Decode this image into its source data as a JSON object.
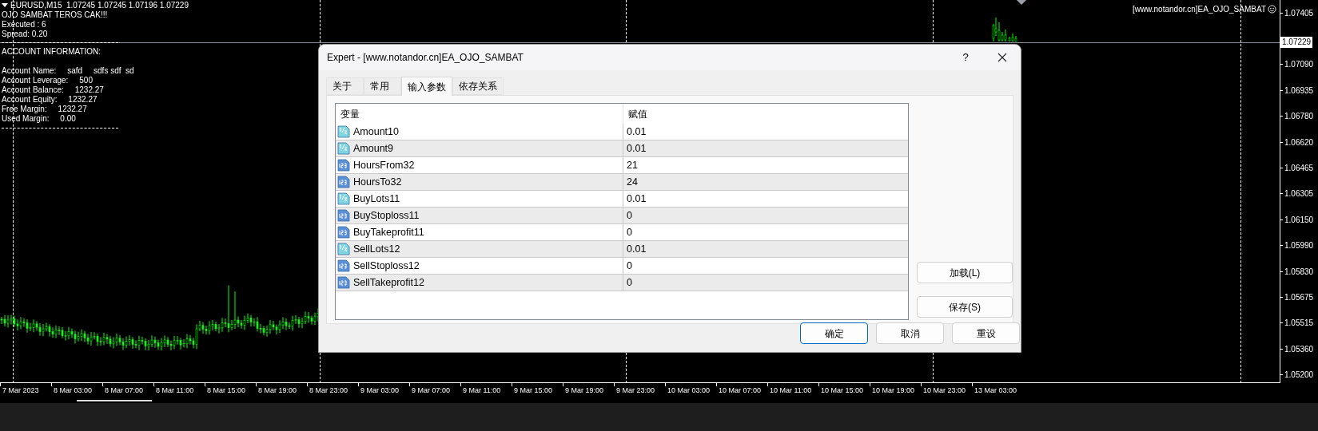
{
  "chart": {
    "symbol_line": "EURUSD,M15  1.07245 1.07245 1.07196 1.07229",
    "info_lines": [
      "OJO SAMBAT TEROS CAK!!!",
      "Executed : 6",
      "Spread: 0.20"
    ],
    "account_title": "ACCOUNT INFORMATION:",
    "account_lines": [
      {
        "label": "Account Name:",
        "value": "safd     sdfs sdf  sd"
      },
      {
        "label": "Account Leverage:",
        "value": "500"
      },
      {
        "label": "Account Balance:",
        "value": "1232.27"
      },
      {
        "label": "Account Equity:",
        "value": "1232.27"
      },
      {
        "label": "Free Margin:",
        "value": "1232.27"
      },
      {
        "label": "Used Margin:",
        "value": "0.00"
      }
    ],
    "expert_label": "[www.notandor.cn]EA_OJO_SAMBAT",
    "price_tag": "1.07229",
    "price_axis": [
      {
        "label": "1.07405"
      },
      {
        "label": "1.07090"
      },
      {
        "label": "1.06935"
      },
      {
        "label": "1.06780"
      },
      {
        "label": "1.06620"
      },
      {
        "label": "1.06465"
      },
      {
        "label": "1.06305"
      },
      {
        "label": "1.06150"
      },
      {
        "label": "1.05990"
      },
      {
        "label": "1.05830"
      },
      {
        "label": "1.05675"
      },
      {
        "label": "1.05515"
      },
      {
        "label": "1.05360"
      },
      {
        "label": "1.05200"
      }
    ],
    "time_axis": [
      "7 Mar 2023",
      "8 Mar 03:00",
      "8 Mar 07:00",
      "8 Mar 11:00",
      "8 Mar 15:00",
      "8 Mar 19:00",
      "8 Mar 23:00",
      "9 Mar 03:00",
      "9 Mar 07:00",
      "9 Mar 11:00",
      "9 Mar 15:00",
      "9 Mar 19:00",
      "9 Mar 23:00",
      "10 Mar 03:00",
      "10 Mar 07:00",
      "10 Mar 11:00",
      "10 Mar 15:00",
      "10 Mar 19:00",
      "10 Mar 23:00",
      "13 Mar 03:00"
    ]
  },
  "dialog": {
    "title": "Expert - [www.notandor.cn]EA_OJO_SAMBAT",
    "help": "?",
    "tabs": [
      {
        "label": "关于",
        "selected": false
      },
      {
        "label": "常用",
        "selected": false
      },
      {
        "label": "输入参数",
        "selected": true
      },
      {
        "label": "依存关系",
        "selected": false
      }
    ],
    "columns": [
      "变量",
      "赋值"
    ],
    "rows": [
      {
        "kind": "double",
        "name": "Amount10",
        "value": "0.01"
      },
      {
        "kind": "double",
        "name": "Amount9",
        "value": "0.01"
      },
      {
        "kind": "int",
        "name": "HoursFrom32",
        "value": "21"
      },
      {
        "kind": "int",
        "name": "HoursTo32",
        "value": "24"
      },
      {
        "kind": "double",
        "name": "BuyLots11",
        "value": "0.01"
      },
      {
        "kind": "int",
        "name": "BuyStoploss11",
        "value": "0"
      },
      {
        "kind": "int",
        "name": "BuyTakeprofit11",
        "value": "0"
      },
      {
        "kind": "double",
        "name": "SellLots12",
        "value": "0.01"
      },
      {
        "kind": "int",
        "name": "SellStoploss12",
        "value": "0"
      },
      {
        "kind": "int",
        "name": "SellTakeprofit12",
        "value": "0"
      }
    ],
    "side_buttons": [
      "加载(L)",
      "保存(S)"
    ],
    "buttons": [
      {
        "label": "确定",
        "selected": true
      },
      {
        "label": "取消",
        "selected": false
      },
      {
        "label": "重设",
        "selected": false
      }
    ]
  }
}
